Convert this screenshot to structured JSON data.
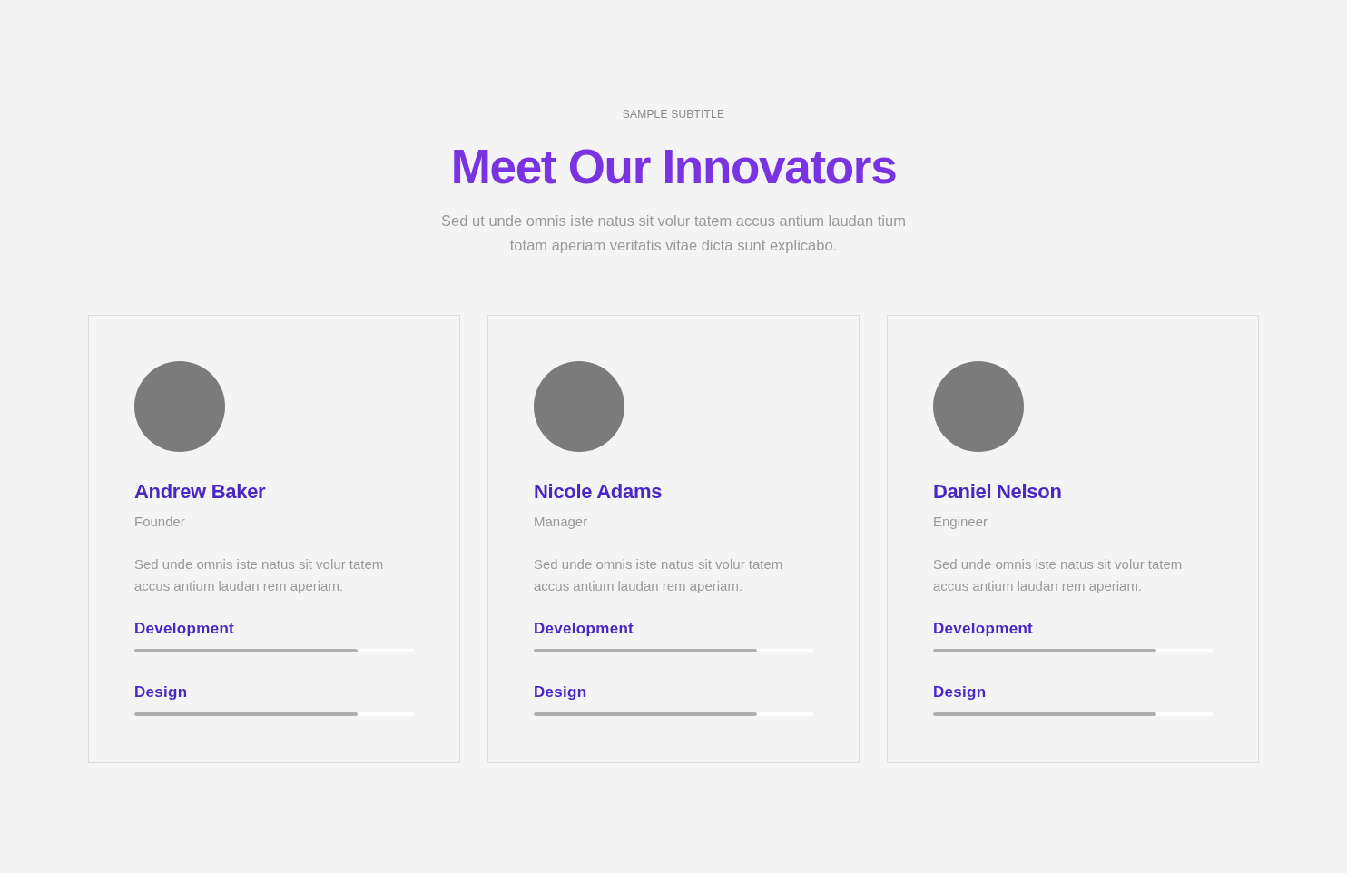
{
  "header": {
    "subtitle": "SAMPLE SUBTITLE",
    "title": "Meet Our Innovators",
    "description": "Sed ut unde omnis iste natus sit volur tatem accus antium laudan tium totam aperiam veritatis vitae dicta sunt explicabo."
  },
  "members": [
    {
      "name": "Andrew Baker",
      "role": "Founder",
      "bio": "Sed unde omnis iste natus sit volur tatem accus antium laudan rem aperiam.",
      "skills": [
        {
          "label": "Development",
          "level": 0.8
        },
        {
          "label": "Design",
          "level": 0.8
        }
      ]
    },
    {
      "name": "Nicole Adams",
      "role": "Manager",
      "bio": "Sed unde omnis iste natus sit volur tatem accus antium laudan rem aperiam.",
      "skills": [
        {
          "label": "Development",
          "level": 0.8
        },
        {
          "label": "Design",
          "level": 0.8
        }
      ]
    },
    {
      "name": "Daniel Nelson",
      "role": "Engineer",
      "bio": "Sed unde omnis iste natus sit volur tatem accus antium laudan rem aperiam.",
      "skills": [
        {
          "label": "Development",
          "level": 0.8
        },
        {
          "label": "Design",
          "level": 0.8
        }
      ]
    }
  ]
}
